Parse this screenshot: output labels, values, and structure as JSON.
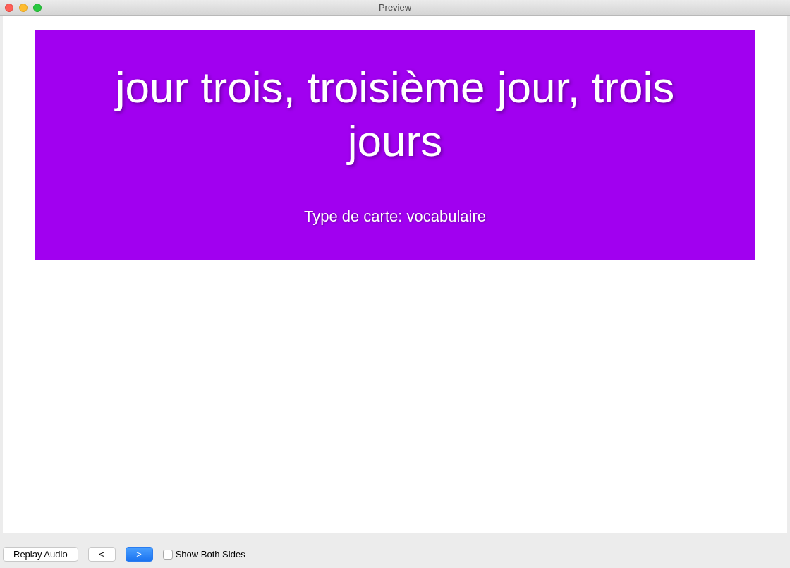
{
  "window": {
    "title": "Preview"
  },
  "card": {
    "title": "jour trois, troisième jour, trois jours",
    "subtitle": "Type de carte: vocabulaire"
  },
  "buttons": [
    {
      "label": "Replay Audio",
      "selected": false
    },
    {
      "label": "<",
      "selected": false
    },
    {
      "label": ">",
      "selected": true
    }
  ],
  "show_both_sides": {
    "label": "Show Both Sides",
    "checked": false
  }
}
